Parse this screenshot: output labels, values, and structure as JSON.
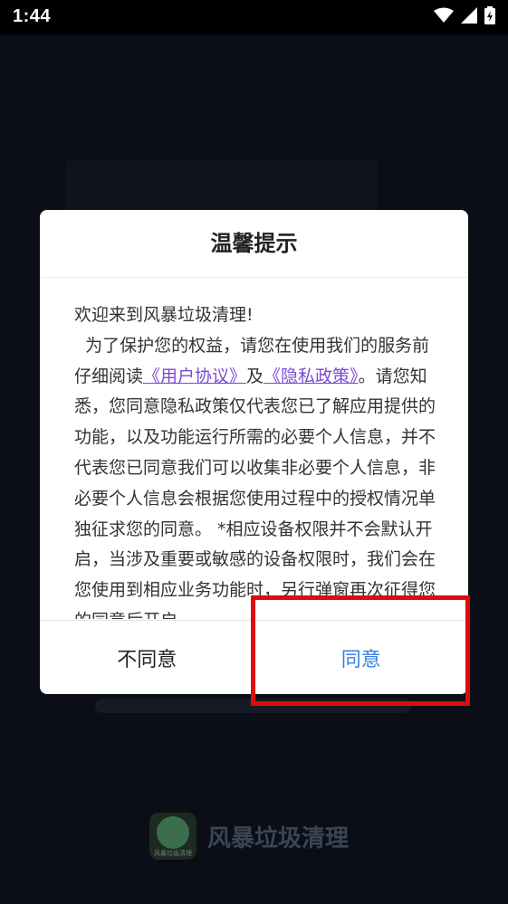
{
  "status_bar": {
    "time": "1:44"
  },
  "dialog": {
    "title": "温馨提示",
    "body": {
      "line1": "欢迎来到风暴垃圾清理!",
      "intro": "  为了保护您的权益，请您在使用我们的服务前仔细阅读",
      "user_agreement": "《用户协议》",
      "and": "及",
      "privacy_policy": "《隐私政策》",
      "period": "。",
      "rest": "请您知悉，您同意隐私政策仅代表您已了解应用提供的功能，以及功能运行所需的必要个人信息，并不代表您已同意我们可以收集非必要个人信息，非必要个人信息会根据您使用过程中的授权情况单独征求您的同意。 *相应设备权限并不会默认开启，当涉及重要或敏感的设备权限时，我们会在您使用到相应业务功能时，另行弹窗再次征得您的同意后开启"
    },
    "buttons": {
      "disagree": "不同意",
      "agree": "同意"
    }
  },
  "footer": {
    "app_name": "风暴垃圾清理",
    "logo_text": "风暴垃圾清理"
  },
  "colors": {
    "link": "#7b4ad6",
    "agree": "#3b7fe0",
    "highlight": "#e00b0b"
  }
}
